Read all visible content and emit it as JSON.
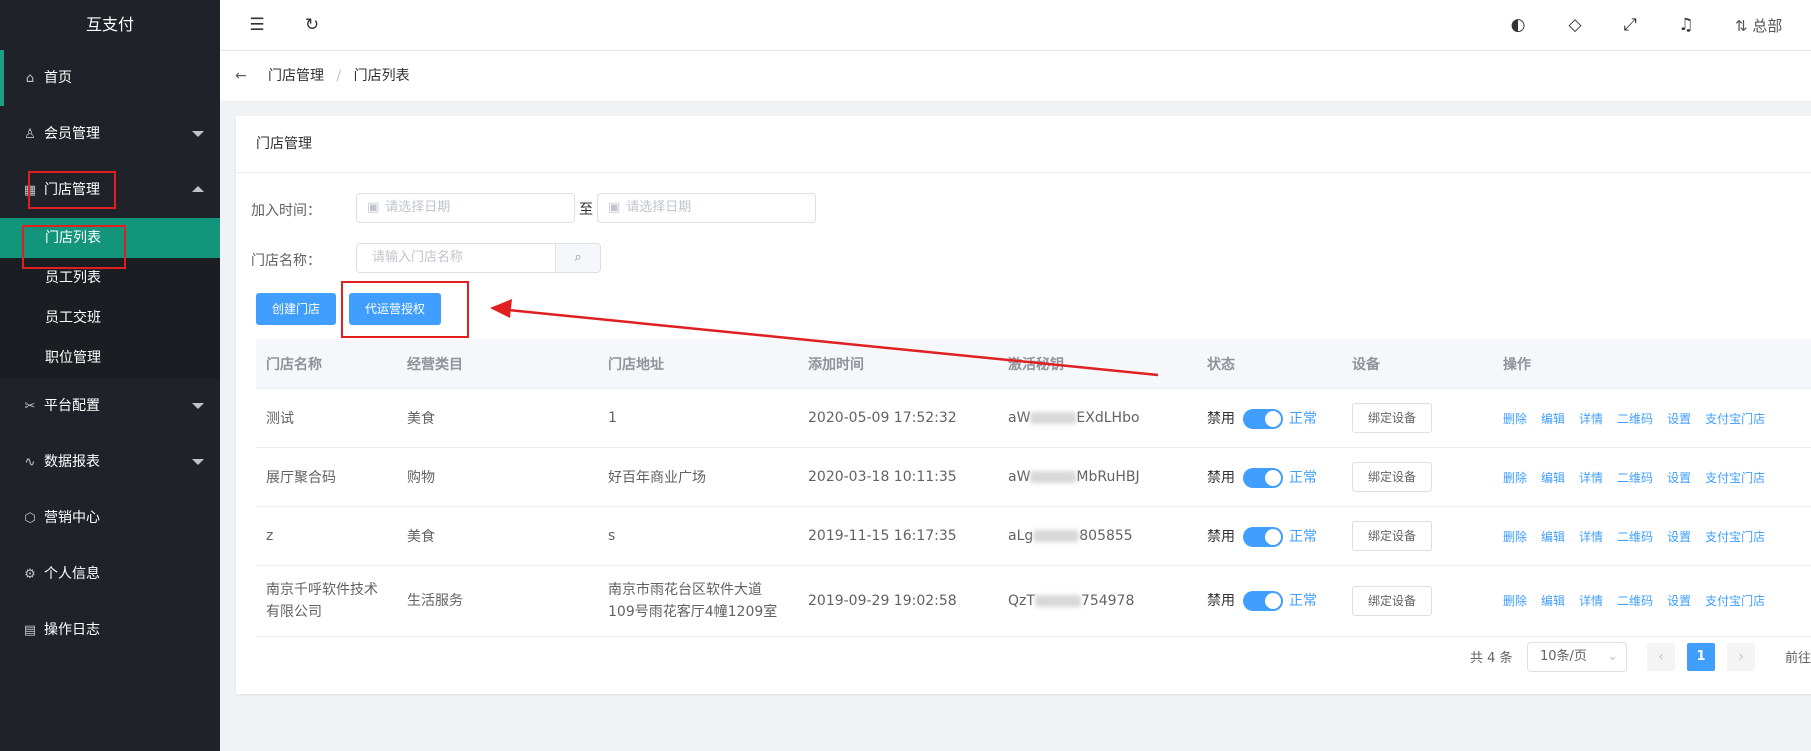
{
  "app": {
    "title": "互支付"
  },
  "sidebar": {
    "items": [
      {
        "label": "首页",
        "icon": "home-icon"
      },
      {
        "label": "会员管理",
        "icon": "user-icon"
      },
      {
        "label": "门店管理",
        "icon": "store-icon"
      },
      {
        "label": "平台配置",
        "icon": "config-icon"
      },
      {
        "label": "数据报表",
        "icon": "chart-icon"
      },
      {
        "label": "营销中心",
        "icon": "box-icon"
      },
      {
        "label": "个人信息",
        "icon": "gear-icon"
      },
      {
        "label": "操作日志",
        "icon": "log-icon"
      }
    ],
    "store_sub": [
      {
        "label": "门店列表"
      },
      {
        "label": "员工列表"
      },
      {
        "label": "员工交班"
      },
      {
        "label": "职位管理"
      }
    ]
  },
  "topbar": {
    "user": "总部"
  },
  "breadcrumb": {
    "parent": "门店管理",
    "sep": "/",
    "current": "门店列表"
  },
  "card": {
    "title": "门店管理"
  },
  "filter": {
    "join_time_label": "加入时间：",
    "date_placeholder": "请选择日期",
    "to": "至",
    "store_name_label": "门店名称：",
    "store_name_placeholder": "请输入门店名称"
  },
  "buttons": {
    "create": "创建门店",
    "auth": "代运营授权"
  },
  "table": {
    "columns": [
      "门店名称",
      "经营类目",
      "门店地址",
      "添加时间",
      "激活秘钥",
      "状态",
      "设备",
      "操作"
    ],
    "rows": [
      {
        "name": "测试",
        "category": "美食",
        "address": "1",
        "time": "2020-05-09 17:52:32",
        "key_prefix": "aW",
        "key_suffix": "EXdLHbo",
        "disable": "禁用",
        "status": "正常",
        "device_btn": "绑定设备"
      },
      {
        "name": "展厅聚合码",
        "category": "购物",
        "address": "好百年商业广场",
        "time": "2020-03-18 10:11:35",
        "key_prefix": "aW",
        "key_suffix": "MbRuHBJ",
        "disable": "禁用",
        "status": "正常",
        "device_btn": "绑定设备"
      },
      {
        "name": "z",
        "category": "美食",
        "address": "s",
        "time": "2019-11-15 16:17:35",
        "key_prefix": "aLg",
        "key_suffix": "805855",
        "disable": "禁用",
        "status": "正常",
        "device_btn": "绑定设备"
      },
      {
        "name": "南京千呼软件技术有限公司",
        "category": "生活服务",
        "address": "南京市雨花台区软件大道109号雨花客厅4幢1209室",
        "time": "2019-09-29 19:02:58",
        "key_prefix": "QzT",
        "key_suffix": "754978",
        "disable": "禁用",
        "status": "正常",
        "device_btn": "绑定设备"
      }
    ],
    "ops": [
      "删除",
      "编辑",
      "详情",
      "二维码",
      "设置",
      "支付宝门店"
    ]
  },
  "pagination": {
    "total": "共 4 条",
    "page_size": "10条/页",
    "current": "1",
    "goto": "前往"
  },
  "colors": {
    "sidebar": "#1f2329",
    "active_green": "#12957b",
    "primary": "#409eff",
    "highlight_red": "#e02020"
  }
}
